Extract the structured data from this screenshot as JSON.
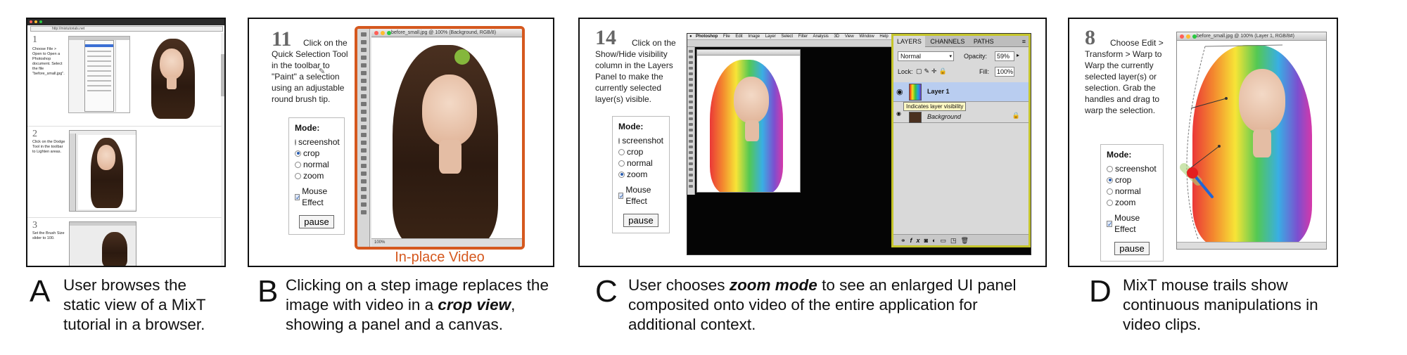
{
  "colors": {
    "highlight_orange": "#d5581e",
    "layer_selected_blue": "#b9cdf0",
    "tooltip_yellow": "#fff9c4"
  },
  "panelA": {
    "url_text": "http://mixtutorials.net",
    "steps": [
      {
        "num": "1",
        "text": "Choose File > Open to Open a Photoshop document. Select the file \"before_small.jpg\"."
      },
      {
        "num": "2",
        "text": "Click on the Dodge Tool in the toolbar to Lighten areas."
      },
      {
        "num": "3",
        "text": "Set the Brush Size slider to 100."
      }
    ]
  },
  "panelB": {
    "step_num": "11",
    "step_text": "Click on the Quick Selection Tool in the toolbar to \"Paint\" a selection using an adjustable round brush tip.",
    "window_title": "before_small.jpg @ 100% (Background, RGB/8)",
    "status_bar": "100%",
    "inplace_label": "In-place Video",
    "mode": {
      "title": "Mode:",
      "options": [
        "screenshot",
        "crop",
        "normal",
        "zoom"
      ],
      "selected": "crop",
      "mouse_effect": "Mouse Effect",
      "pause": "pause"
    }
  },
  "panelC": {
    "step_num": "14",
    "step_text": "Click on the Show/Hide visibility column in the Layers Panel to make the currently selected layer(s) visible.",
    "menu_items": [
      "Photoshop",
      "File",
      "Edit",
      "Image",
      "Layer",
      "Select",
      "Filter",
      "Analysis",
      "3D",
      "View",
      "Window",
      "Help"
    ],
    "layers_tabs": [
      "LAYERS",
      "CHANNELS",
      "PATHS"
    ],
    "blend_mode": "Normal",
    "opacity_label": "Opacity:",
    "opacity_value": "59%",
    "lock_label": "Lock:",
    "fill_label": "Fill:",
    "fill_value": "100%",
    "layers": [
      "Layer 1",
      "Background"
    ],
    "tooltip": "Indicates layer visibility",
    "mode": {
      "title": "Mode:",
      "options": [
        "screenshot",
        "crop",
        "normal",
        "zoom"
      ],
      "selected": "zoom",
      "mouse_effect": "Mouse Effect",
      "pause": "pause"
    }
  },
  "panelD": {
    "step_num": "8",
    "step_text": "Choose Edit > Transform > Warp to Warp the currently selected layer(s) or selection. Grab the handles and drag to warp the selection.",
    "window_title": "before_small.jpg @ 100% (Layer 1, RGB/8#)",
    "mode": {
      "title": "Mode:",
      "options": [
        "screenshot",
        "crop",
        "normal",
        "zoom"
      ],
      "selected": "crop",
      "mouse_effect": "Mouse Effect",
      "pause": "pause"
    }
  },
  "captions": [
    {
      "letter": "A",
      "text": "User browses the static view of a MixT tutorial in a browser."
    },
    {
      "letter": "B",
      "pre": "Clicking on a step image replaces the image with video in a ",
      "em": "crop view",
      "post": ", showing a panel and a canvas."
    },
    {
      "letter": "C",
      "pre": "User chooses ",
      "em": "zoom mode",
      "post": " to see an enlarged UI panel composited onto video of the entire application for additional context."
    },
    {
      "letter": "D",
      "text": "MixT mouse trails show continuous manipulations in video clips."
    }
  ]
}
